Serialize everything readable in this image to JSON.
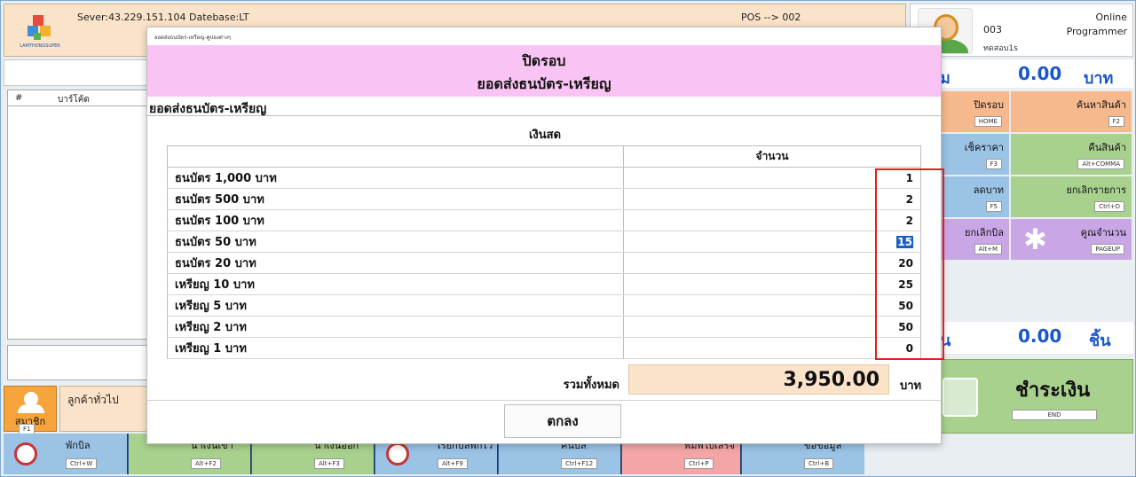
{
  "background": {
    "server_info": "Sever:43.229.151.104 Datebase:LT",
    "pos_link": "POS --> 002",
    "logo_text": "LAMTHONGSUPER",
    "user": {
      "code": "003",
      "subtitle": "ทดสอบ1s",
      "status": "Online",
      "role": "Programmer"
    },
    "grid_headers": {
      "index": "#",
      "barcode": "บาร์โค้ด"
    },
    "total_amount": "0.00",
    "amount_unit": "บาท",
    "amount_edge": "ม",
    "total_count": "0.00",
    "count_unit": "ชิ้น",
    "count_edge": "น",
    "member": {
      "label": "สมาชิก",
      "key": "F1"
    },
    "customer": "ลูกค้าทั่วไป",
    "function_buttons": [
      {
        "label": "ปิดรอบ",
        "key": "HOME",
        "color": "#f6b98e"
      },
      {
        "label": "ค้นหาสินค้า",
        "key": "F2",
        "color": "#f6b98e"
      },
      {
        "label": "เช็คราคา",
        "key": "F3",
        "color": "#9bc3e6"
      },
      {
        "label": "คืนสินค้า",
        "key": "Alt+COMMA",
        "color": "#a9d18e"
      },
      {
        "label": "ลดบาท",
        "key": "F5",
        "color": "#9bc3e6"
      },
      {
        "label": "ยกเลิกรายการ",
        "key": "Ctrl+D",
        "color": "#a9d18e"
      },
      {
        "label": "ยกเลิกบิล",
        "key": "Alt+M",
        "color": "#c9a6e6"
      },
      {
        "label": "คูณจำนวน",
        "key": "PAGEUP",
        "color": "#c9a6e6"
      }
    ],
    "pay": {
      "label": "ชำระเงิน",
      "key": "END"
    },
    "bottom_buttons": [
      {
        "label": "พักบิล",
        "key": "Ctrl+W",
        "color": "#9bc3e6"
      },
      {
        "label": "นำเงินเข้า",
        "key": "Alt+F2",
        "color": "#a9d18e"
      },
      {
        "label": "นำเงินออก",
        "key": "Alt+F3",
        "color": "#a9d18e"
      },
      {
        "label": "เรียกบิลพักไว้",
        "key": "Alt+F9",
        "color": "#9bc3e6"
      },
      {
        "label": "คืนบิล",
        "key": "Ctrl+F12",
        "color": "#9bc3e6"
      },
      {
        "label": "พิมพ์ใบเสร็จ",
        "key": "Ctrl+P",
        "color": "#f4a6a6"
      },
      {
        "label": "ขอข้อมูล",
        "key": "Ctrl+B",
        "color": "#9bc3e6"
      }
    ]
  },
  "modal": {
    "window_title": "ยอดส่งธนบัตร-เหรียญ-คูปองต่างๆ",
    "header_line1": "ปิดรอบ",
    "header_line2": "ยอดส่งธนบัตร-เหรียญ",
    "section_title": "ยอดส่งธนบัตร-เหรียญ",
    "cash_title": "เงินสด",
    "column_quantity": "จำนวน",
    "rows": [
      {
        "label": "ธนบัตร 1,000 บาท",
        "value": "1"
      },
      {
        "label": "ธนบัตร 500 บาท",
        "value": "2"
      },
      {
        "label": "ธนบัตร 100 บาท",
        "value": "2"
      },
      {
        "label": "ธนบัตร 50 บาท",
        "value": "15"
      },
      {
        "label": "ธนบัตร 20 บาท",
        "value": "20"
      },
      {
        "label": "เหรียญ 10 บาท",
        "value": "25"
      },
      {
        "label": "เหรียญ 5 บาท",
        "value": "50"
      },
      {
        "label": "เหรียญ 2 บาท",
        "value": "50"
      },
      {
        "label": "เหรียญ 1 บาท",
        "value": "0"
      }
    ],
    "selected_row_index": 3,
    "total_label": "รวมทั้งหมด",
    "total_value": "3,950.00",
    "total_unit": "บาท",
    "ok_label": "ตกลง"
  }
}
